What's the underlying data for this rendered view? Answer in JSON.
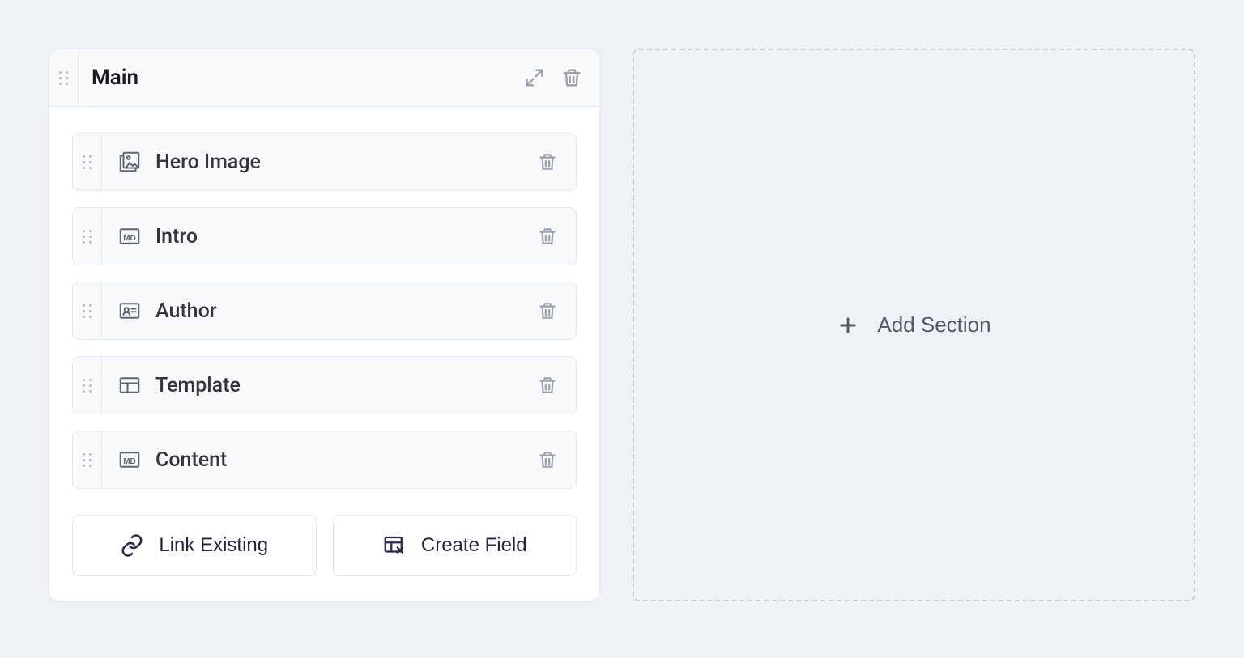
{
  "section": {
    "title": "Main",
    "fields": [
      {
        "label": "Hero Image",
        "icon": "image-icon"
      },
      {
        "label": "Intro",
        "icon": "md-icon"
      },
      {
        "label": "Author",
        "icon": "author-icon"
      },
      {
        "label": "Template",
        "icon": "template-icon"
      },
      {
        "label": "Content",
        "icon": "md-icon"
      }
    ],
    "link_existing_label": "Link Existing",
    "create_field_label": "Create Field"
  },
  "add_section_label": "Add Section"
}
